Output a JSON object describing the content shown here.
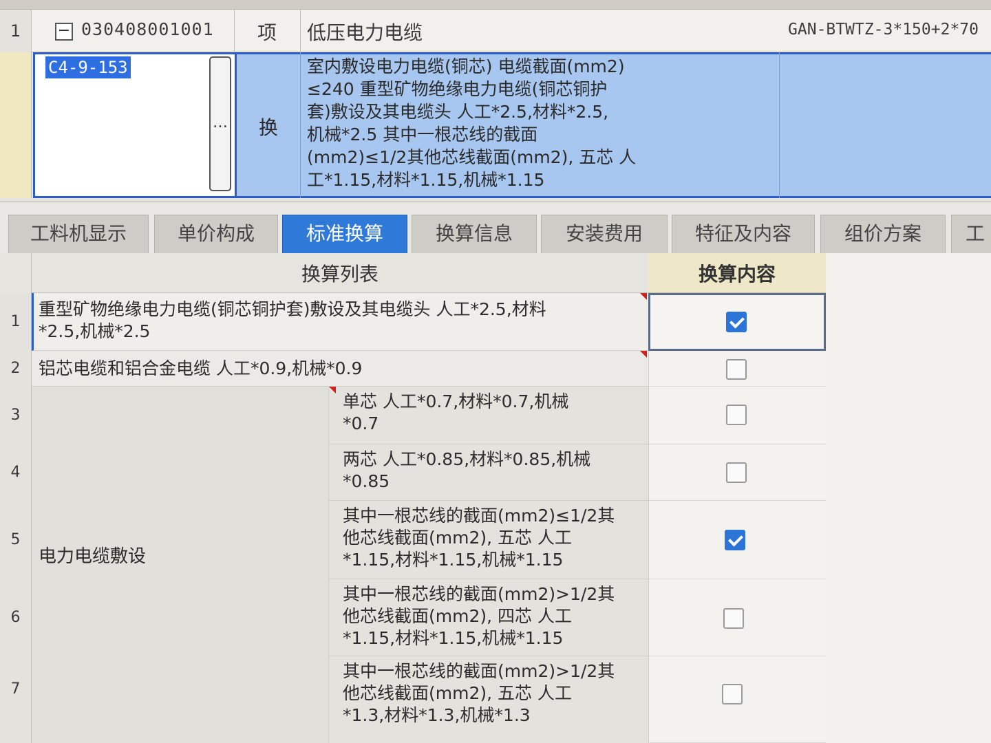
{
  "top_grid": {
    "row1": {
      "num": "1",
      "collapse": "−",
      "code": "030408001001",
      "type": "项",
      "name": "低压电力电缆",
      "spec": "GAN-BTWTZ-3*150+2*70"
    },
    "row2": {
      "code": "C4-9-153",
      "ellipsis": "…",
      "type": "换",
      "desc_lines": [
        "室内敷设电力电缆(铜芯) 电缆截面(mm2)",
        "≤240  重型矿物绝缘电力电缆(铜芯铜护",
        "套)敷设及其电缆头 人工*2.5,材料*2.5,",
        "机械*2.5  其中一根芯线的截面",
        "(mm2)≤1/2其他芯线截面(mm2), 五芯 人",
        "工*1.15,材料*1.15,机械*1.15"
      ]
    }
  },
  "tabs": [
    {
      "label": "工料机显示",
      "active": false
    },
    {
      "label": "单价构成",
      "active": false
    },
    {
      "label": "标准换算",
      "active": true
    },
    {
      "label": "换算信息",
      "active": false
    },
    {
      "label": "安装费用",
      "active": false
    },
    {
      "label": "特征及内容",
      "active": false
    },
    {
      "label": "组价方案",
      "active": false
    },
    {
      "label": "工",
      "active": false
    }
  ],
  "conversion_table": {
    "header_list": "换算列表",
    "header_content": "换算内容",
    "group_label": "电力电缆敷设",
    "rows": [
      {
        "num": "1",
        "lines": [
          "重型矿物绝缘电力电缆(铜芯铜护套)敷设及其电缆头 人工*2.5,材料",
          "*2.5,机械*2.5"
        ],
        "checked": true
      },
      {
        "num": "2",
        "lines": [
          "铝芯电缆和铝合金电缆 人工*0.9,机械*0.9"
        ],
        "checked": false
      },
      {
        "num": "3",
        "lines": [
          "单芯 人工*0.7,材料*0.7,机械",
          "*0.7"
        ],
        "checked": false
      },
      {
        "num": "4",
        "lines": [
          "两芯 人工*0.85,材料*0.85,机械",
          "*0.85"
        ],
        "checked": false
      },
      {
        "num": "5",
        "lines": [
          "其中一根芯线的截面(mm2)≤1/2其",
          "他芯线截面(mm2), 五芯 人工",
          "*1.15,材料*1.15,机械*1.15"
        ],
        "checked": true
      },
      {
        "num": "6",
        "lines": [
          "其中一根芯线的截面(mm2)>1/2其",
          "他芯线截面(mm2), 四芯 人工",
          "*1.15,材料*1.15,机械*1.15"
        ],
        "checked": false
      },
      {
        "num": "7",
        "lines": [
          "其中一根芯线的截面(mm2)>1/2其",
          "他芯线截面(mm2), 五芯 人工",
          "*1.3,材料*1.3,机械*1.3"
        ],
        "checked": false
      }
    ]
  },
  "colors": {
    "selection": "#a8c7f0",
    "active_tab": "#2f7ad8",
    "checkbox_checked": "#2d74d8",
    "header_highlight": "#efe8c8"
  }
}
